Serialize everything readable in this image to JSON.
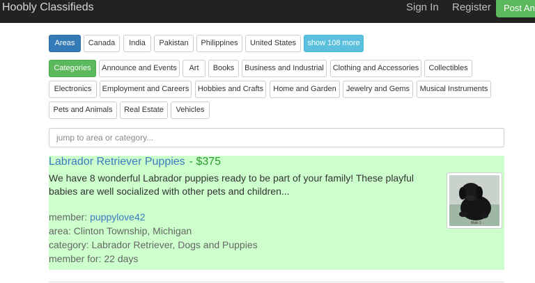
{
  "navbar": {
    "brand": "Hoobly Classifieds",
    "sign_in": "Sign In",
    "register": "Register",
    "post_ad": "Post An Ad"
  },
  "areas": {
    "label": "Areas",
    "items": [
      "Canada",
      "India",
      "Pakistan",
      "Philippines",
      "United States"
    ],
    "more": "show 108 more"
  },
  "categories": {
    "label": "Categories",
    "items": [
      "Announce and Events",
      "Art",
      "Books",
      "Business and Industrial",
      "Clothing and Accessories",
      "Collectibles",
      "Electronics",
      "Employment and Careers",
      "Hobbies and Crafts",
      "Home and Garden",
      "Jewelry and Gems",
      "Musical Instruments",
      "Pets and Animals",
      "Real Estate",
      "Vehicles"
    ]
  },
  "search": {
    "placeholder": "jump to area or category..."
  },
  "listing": {
    "title": "Labrador Retriever Puppies",
    "price": "- $375",
    "description": "We have 8 wonderful Labrador puppies ready to be part of your family! These playful babies are well socialized with other pets and children...",
    "member_label": "member:",
    "member": "puppylove42",
    "area": "area: Clinton Township, Michigan",
    "category": "category: Labrador Retriever, Dogs and Puppies",
    "member_for": "member for: 22 days",
    "thumb_caption": "Male 1"
  },
  "colors": {
    "navbar_bg": "#222222",
    "primary": "#337ab7",
    "success": "#5cb85c",
    "info": "#5bc0de",
    "listing_bg": "#ccffcc",
    "link": "#3b7bbf",
    "price": "#2e9a2e"
  }
}
